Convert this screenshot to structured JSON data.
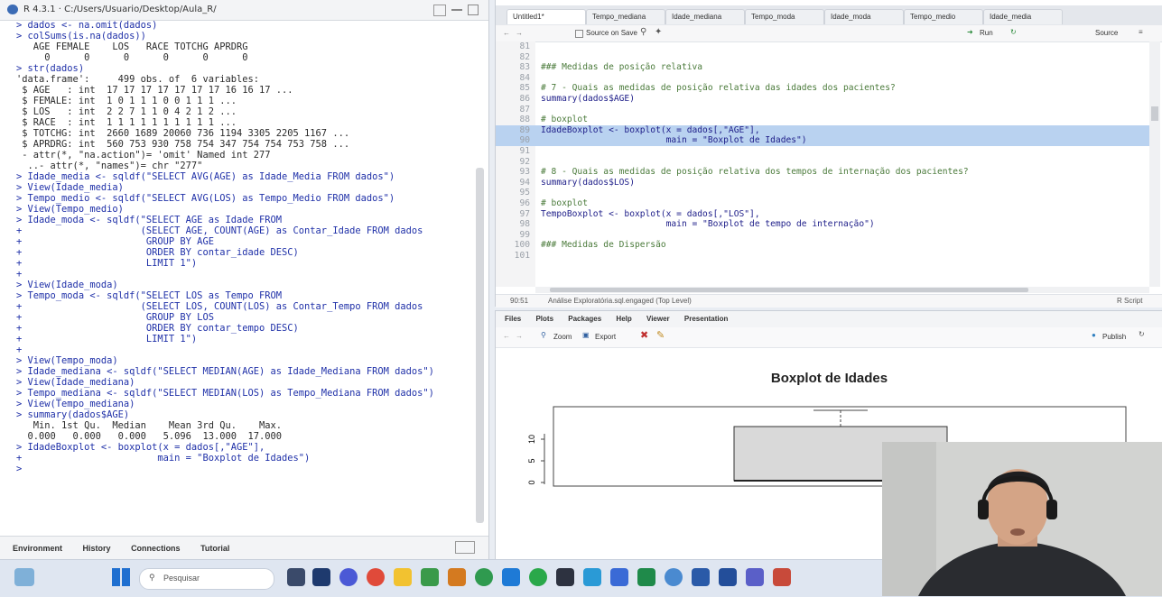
{
  "console": {
    "header_title": "R 4.3.1 · C:/Users/Usuario/Desktop/Aula_R/",
    "lines": [
      {
        "t": "> dados <- na.omit(dados)",
        "k": "cmd"
      },
      {
        "t": "> colSums(is.na(dados))",
        "k": "cmd"
      },
      {
        "t": "   AGE FEMALE    LOS   RACE TOTCHG APRDRG",
        "k": "out"
      },
      {
        "t": "     0      0      0      0      0      0",
        "k": "out"
      },
      {
        "t": "> str(dados)",
        "k": "cmd"
      },
      {
        "t": "'data.frame':     499 obs. of  6 variables:",
        "k": "out"
      },
      {
        "t": " $ AGE   : int  17 17 17 17 17 17 17 16 16 17 ...",
        "k": "out"
      },
      {
        "t": " $ FEMALE: int  1 0 1 1 1 0 0 1 1 1 ...",
        "k": "out"
      },
      {
        "t": " $ LOS   : int  2 2 7 1 1 0 4 2 1 2 ...",
        "k": "out"
      },
      {
        "t": " $ RACE  : int  1 1 1 1 1 1 1 1 1 1 ...",
        "k": "out"
      },
      {
        "t": " $ TOTCHG: int  2660 1689 20060 736 1194 3305 2205 1167 ...",
        "k": "out"
      },
      {
        "t": " $ APRDRG: int  560 753 930 758 754 347 754 754 753 758 ...",
        "k": "out"
      },
      {
        "t": " - attr(*, \"na.action\")= 'omit' Named int 277",
        "k": "out"
      },
      {
        "t": "  ..- attr(*, \"names\")= chr \"277\"",
        "k": "out"
      },
      {
        "t": "> Idade_media <- sqldf(\"SELECT AVG(AGE) as Idade_Media FROM dados\")",
        "k": "cmd"
      },
      {
        "t": "> View(Idade_media)",
        "k": "cmd"
      },
      {
        "t": "> Tempo_medio <- sqldf(\"SELECT AVG(LOS) as Tempo_Medio FROM dados\")",
        "k": "cmd"
      },
      {
        "t": "> View(Tempo_medio)",
        "k": "cmd"
      },
      {
        "t": "> Idade_moda <- sqldf(\"SELECT AGE as Idade FROM",
        "k": "cmd"
      },
      {
        "t": "+                     (SELECT AGE, COUNT(AGE) as Contar_Idade FROM dados",
        "k": "cmd"
      },
      {
        "t": "+                      GROUP BY AGE",
        "k": "cmd"
      },
      {
        "t": "+                      ORDER BY contar_idade DESC)",
        "k": "cmd"
      },
      {
        "t": "+                      LIMIT 1\")",
        "k": "cmd"
      },
      {
        "t": "+",
        "k": "cmd"
      },
      {
        "t": "> View(Idade_moda)",
        "k": "cmd"
      },
      {
        "t": "> Tempo_moda <- sqldf(\"SELECT LOS as Tempo FROM",
        "k": "cmd"
      },
      {
        "t": "+                     (SELECT LOS, COUNT(LOS) as Contar_Tempo FROM dados",
        "k": "cmd"
      },
      {
        "t": "+                      GROUP BY LOS",
        "k": "cmd"
      },
      {
        "t": "+                      ORDER BY contar_tempo DESC)",
        "k": "cmd"
      },
      {
        "t": "+                      LIMIT 1\")",
        "k": "cmd"
      },
      {
        "t": "+",
        "k": "cmd"
      },
      {
        "t": "> View(Tempo_moda)",
        "k": "cmd"
      },
      {
        "t": "> Idade_mediana <- sqldf(\"SELECT MEDIAN(AGE) as Idade_Mediana FROM dados\")",
        "k": "cmd"
      },
      {
        "t": "> View(Idade_mediana)",
        "k": "cmd"
      },
      {
        "t": "> Tempo_mediana <- sqldf(\"SELECT MEDIAN(LOS) as Tempo_Mediana FROM dados\")",
        "k": "cmd"
      },
      {
        "t": "> View(Tempo_mediana)",
        "k": "cmd"
      },
      {
        "t": "> summary(dados$AGE)",
        "k": "cmd"
      },
      {
        "t": "   Min. 1st Qu.  Median    Mean 3rd Qu.    Max.",
        "k": "out"
      },
      {
        "t": "  0.000   0.000   0.000   5.096  13.000  17.000",
        "k": "out"
      },
      {
        "t": "> IdadeBoxplot <- boxplot(x = dados[,\"AGE\"],",
        "k": "cmd"
      },
      {
        "t": "+                        main = \"Boxplot de Idades\")",
        "k": "cmd"
      },
      {
        "t": ">",
        "k": "cmd"
      }
    ],
    "tabs": [
      "Environment",
      "History",
      "Connections",
      "Tutorial"
    ]
  },
  "source": {
    "tabs": [
      "Untitled1*",
      "Tempo_mediana",
      "Idade_mediana",
      "Tempo_moda",
      "Idade_moda",
      "Tempo_medio",
      "Idade_media"
    ],
    "toolbar": {
      "source_on_save": "Source on Save",
      "run": "Run",
      "source": "Source"
    },
    "code": [
      {
        "n": "81",
        "t": "",
        "k": "code"
      },
      {
        "n": "82",
        "t": "",
        "k": "code"
      },
      {
        "n": "83",
        "t": "### Medidas de posição relativa",
        "k": "com"
      },
      {
        "n": "84",
        "t": "",
        "k": "code"
      },
      {
        "n": "85",
        "t": "# 7 - Quais as medidas de posição relativa das idades dos pacientes?",
        "k": "com"
      },
      {
        "n": "86",
        "t": "summary(dados$AGE)",
        "k": "code"
      },
      {
        "n": "87",
        "t": "",
        "k": "code"
      },
      {
        "n": "88",
        "t": "# boxplot",
        "k": "com"
      },
      {
        "n": "89",
        "t": "IdadeBoxplot <- boxplot(x = dados[,\"AGE\"],",
        "k": "code",
        "hl": true
      },
      {
        "n": "90",
        "t": "                        main = \"Boxplot de Idades\")",
        "k": "code",
        "hl": true
      },
      {
        "n": "91",
        "t": "",
        "k": "code"
      },
      {
        "n": "92",
        "t": "",
        "k": "code"
      },
      {
        "n": "93",
        "t": "# 8 - Quais as medidas de posição relativa dos tempos de internação dos pacientes?",
        "k": "com"
      },
      {
        "n": "94",
        "t": "summary(dados$LOS)",
        "k": "code"
      },
      {
        "n": "95",
        "t": "",
        "k": "code"
      },
      {
        "n": "96",
        "t": "# boxplot",
        "k": "com"
      },
      {
        "n": "97",
        "t": "TempoBoxplot <- boxplot(x = dados[,\"LOS\"],",
        "k": "code"
      },
      {
        "n": "98",
        "t": "                        main = \"Boxplot de tempo de internação\")",
        "k": "code"
      },
      {
        "n": "99",
        "t": "",
        "k": "code"
      },
      {
        "n": "100",
        "t": "### Medidas de Dispersão",
        "k": "com"
      },
      {
        "n": "101",
        "t": "",
        "k": "code"
      }
    ],
    "status_left": "90:51",
    "status_mid": "Análise Exploratória.sql.engaged (Top Level)",
    "status_right": "R Script"
  },
  "plots": {
    "tabs": [
      "Files",
      "Plots",
      "Packages",
      "Help",
      "Viewer",
      "Presentation"
    ],
    "toolbar": {
      "zoom": "Zoom",
      "export": "Export",
      "publish": "Publish"
    },
    "title": "Boxplot de Idades",
    "y_ticks": [
      "10",
      "5",
      "0"
    ]
  },
  "taskbar": {
    "search_placeholder": "Pesquisar"
  },
  "colors": {
    "selection": "#b9d2f0",
    "comment": "#4a7a3a",
    "keyword": "#20208a",
    "console_cmd": "#1f30a8"
  }
}
